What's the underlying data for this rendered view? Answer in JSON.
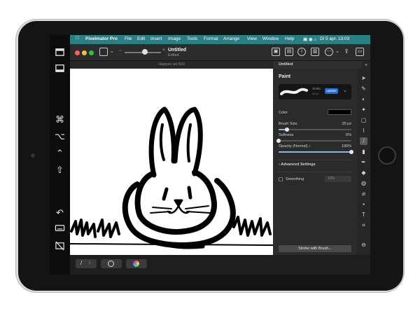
{
  "menubar": {
    "app_name": "Pixelmator Pro",
    "items": [
      "File",
      "Edit",
      "Insert",
      "Image",
      "Tools",
      "Format",
      "Arrange",
      "View",
      "Window",
      "Help"
    ],
    "datetime": "Di 5 apr.  13:03"
  },
  "document": {
    "title": "Untitled",
    "subtitle": "Edited"
  },
  "tabs": {
    "canvas_tab": "Happen ad 600",
    "active_tab": "Untitled"
  },
  "panel": {
    "title": "Paint",
    "brush_name": "Jimbo",
    "brush_size_label": "40 pt",
    "update_label": "Update",
    "color_label": "Color",
    "color_value": "#000000",
    "brush_size": {
      "label": "Brush Size",
      "value": "35 px",
      "level": 0.12
    },
    "softness": {
      "label": "Softness",
      "value": "0%",
      "level": 0.0
    },
    "opacity": {
      "label": "Opacity (Normal) ↕",
      "value": "100%",
      "level": 1.0
    },
    "advanced_label": "Advanced Settings",
    "smoothing_label": "Smoothing",
    "smoothing_value": "10%",
    "stroke_button": "Stroke with Brush..."
  },
  "icons": {
    "sidecar": [
      "sidebar-icon",
      "toolbar-icon",
      "command-icon",
      "option-icon",
      "control-icon",
      "shift-icon",
      "undo-icon",
      "keyboard-icon",
      "disconnect-icon"
    ],
    "tools": [
      "arrange-icon",
      "style-icon",
      "color-adjust-icon",
      "effects-icon",
      "crop-select-icon",
      "paint-brush-icon",
      "retouch-icon",
      "pen-icon",
      "eraser-icon",
      "fill-icon",
      "color-picker-icon",
      "shape-icon",
      "text-icon",
      "crop-icon"
    ]
  },
  "colors": {
    "menubar": "#2a7f84",
    "accent": "#1f6fd6"
  }
}
